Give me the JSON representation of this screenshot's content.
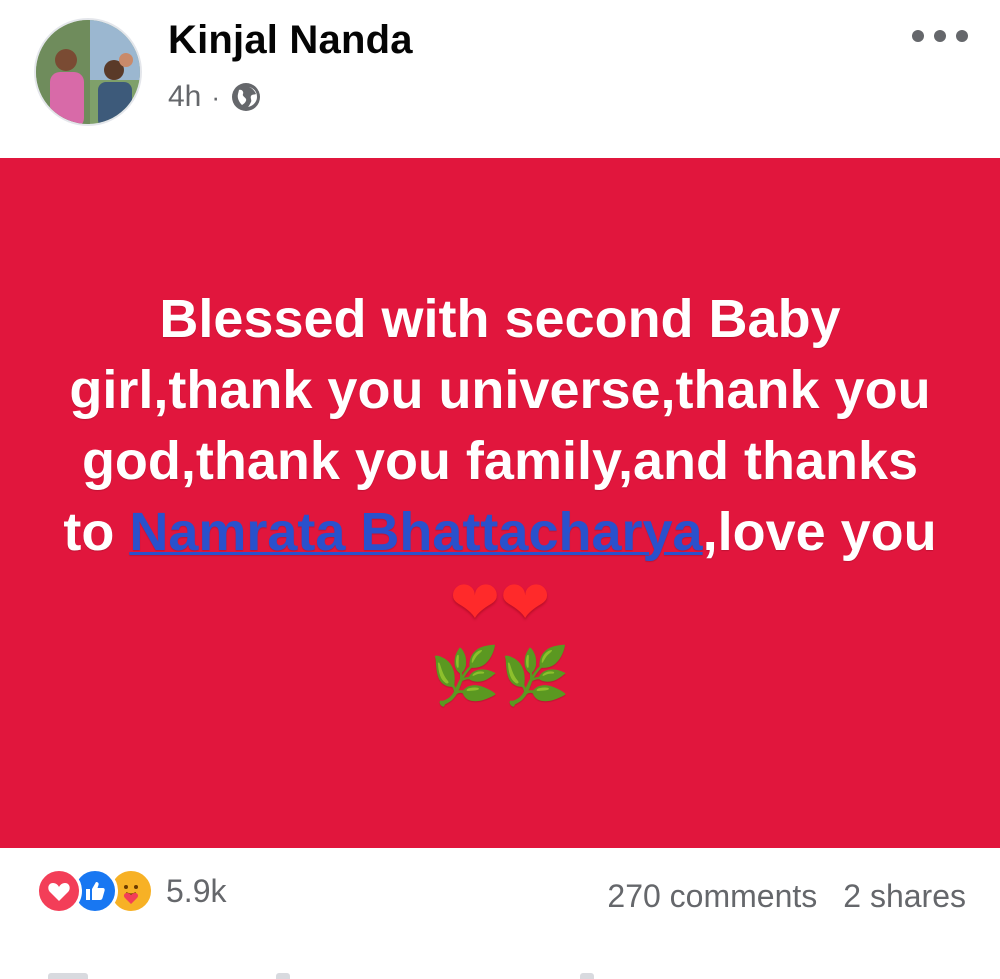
{
  "post": {
    "author": "Kinjal Nanda",
    "time": "4h",
    "separator": "·",
    "privacy_icon": "globe-icon",
    "more_icon": "more-options-icon"
  },
  "content": {
    "background_color": "#e1163d",
    "text_before_mention": "Blessed with second Baby girl,thank you universe,thank you god,thank you family,and thanks to ",
    "mention": "Namrata Bhattacharya",
    "text_after_mention": ",love you ",
    "emoji_hearts": "❤❤",
    "emoji_leaves": "🌿🌿"
  },
  "footer": {
    "reaction_icons": [
      "love-reaction-icon",
      "like-reaction-icon",
      "care-reaction-icon"
    ],
    "reaction_count": "5.9k",
    "comments": "270 comments",
    "shares": "2 shares"
  },
  "colors": {
    "accent_blue": "#1877f2",
    "mention_blue": "#2a51cc",
    "secondary_text": "#65676b"
  }
}
